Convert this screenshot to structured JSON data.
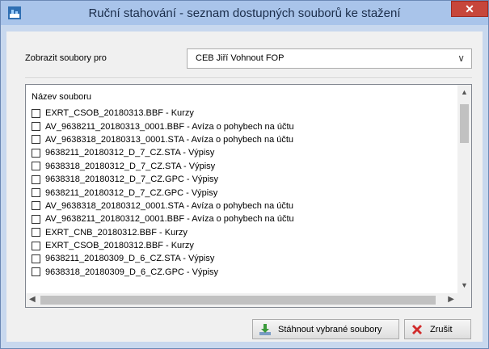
{
  "window": {
    "title": "Ruční stahování - seznam dostupných souborů ke stažení",
    "close_glyph": "✕"
  },
  "filter": {
    "label": "Zobrazit soubory pro",
    "selected": "CEB Jiří Vohnout FOP"
  },
  "list": {
    "header": "Název souboru",
    "items": [
      "EXRT_CSOB_20180313.BBF - Kurzy",
      "AV_9638211_20180313_0001.BBF - Avíza o pohybech na účtu",
      "AV_9638318_20180313_0001.STA - Avíza o pohybech na účtu",
      "9638211_20180312_D_7_CZ.STA - Výpisy",
      "9638318_20180312_D_7_CZ.STA - Výpisy",
      "9638318_20180312_D_7_CZ.GPC - Výpisy",
      "9638211_20180312_D_7_CZ.GPC - Výpisy",
      "AV_9638318_20180312_0001.STA - Avíza o pohybech na účtu",
      "AV_9638211_20180312_0001.BBF - Avíza o pohybech na účtu",
      "EXRT_CNB_20180312.BBF - Kurzy",
      "EXRT_CSOB_20180312.BBF - Kurzy",
      "9638211_20180309_D_6_CZ.STA - Výpisy",
      "9638318_20180309_D_6_CZ.GPC - Výpisy"
    ]
  },
  "buttons": {
    "download": "Stáhnout vybrané soubory",
    "close": "Zrušit"
  },
  "icons": {
    "app": "app-icon",
    "download": "download-icon",
    "cancel": "red-x-icon"
  },
  "colors": {
    "titlebar": "#a9c4ea",
    "close_button": "#c7463b",
    "cancel_x": "#d12b2b",
    "download_arrow": "#3a9a3a"
  }
}
